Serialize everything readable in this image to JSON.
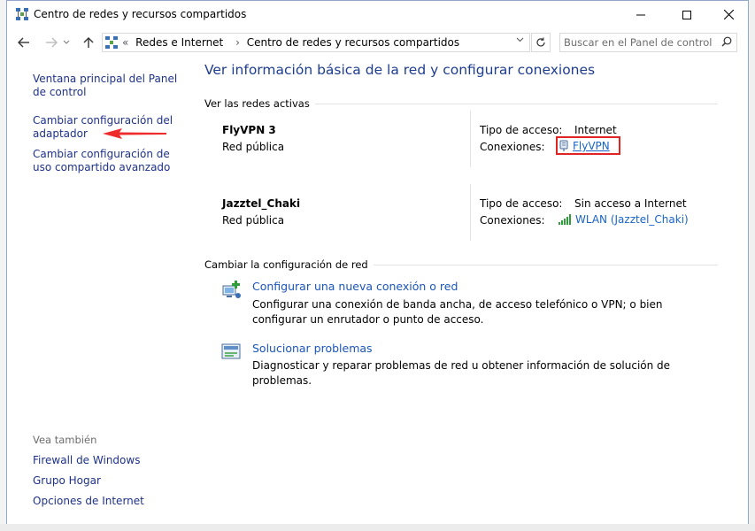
{
  "window": {
    "title": "Centro de redes y recursos compartidos",
    "controls": {
      "minimize": "—",
      "maximize": "☐",
      "close": "✕"
    }
  },
  "nav": {
    "breadcrumb_prefix": "«",
    "crumbs": [
      "Redes e Internet",
      "Centro de redes y recursos compartidos"
    ],
    "crumb_separator": "›",
    "search_placeholder": "Buscar en el Panel de control"
  },
  "left": {
    "links": [
      "Ventana principal del Panel de control",
      "Cambiar configuración del adaptador",
      "Cambiar configuración de uso compartido avanzado"
    ],
    "see_also_title": "Vea también",
    "see_also": [
      "Firewall de Windows",
      "Grupo Hogar",
      "Opciones de Internet"
    ]
  },
  "main": {
    "title": "Ver información básica de la red y configurar conexiones",
    "active_networks_label": "Ver las redes activas",
    "networks": [
      {
        "name": "FlyVPN  3",
        "type": "Red pública",
        "access_label": "Tipo de acceso:",
        "access_value": "Internet",
        "connections_label": "Conexiones:",
        "connection": "FlyVPN",
        "connection_icon": "vpn-connection-icon"
      },
      {
        "name": "Jazztel_Chaki",
        "type": "Red pública",
        "access_label": "Tipo de acceso:",
        "access_value": "Sin acceso a Internet",
        "connections_label": "Conexiones:",
        "connection": "WLAN (Jazztel_Chaki)",
        "connection_icon": "wifi-signal-icon"
      }
    ],
    "change_label": "Cambiar la configuración de red",
    "tasks": [
      {
        "link": "Configurar una nueva conexión o red",
        "description": "Configurar una conexión de banda ancha, de acceso telefónico o VPN; o bien configurar un enrutador o punto de acceso.",
        "icon": "new-connection-icon"
      },
      {
        "link": "Solucionar problemas",
        "description": "Diagnosticar y reparar problemas de red u obtener información de solución de problemas.",
        "icon": "troubleshoot-icon"
      }
    ]
  },
  "colors": {
    "link": "#1a55b8",
    "title": "#1e3d8f",
    "highlight": "#e02424",
    "arrow": "#ee2c2c"
  }
}
